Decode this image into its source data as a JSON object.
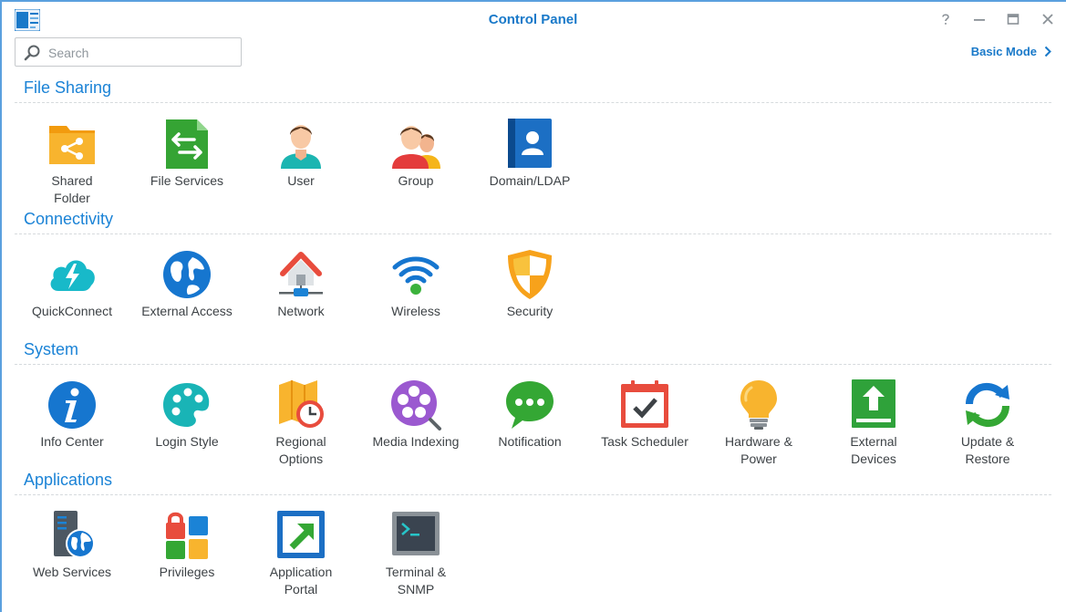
{
  "window": {
    "title": "Control Panel"
  },
  "search": {
    "placeholder": "Search"
  },
  "basic_mode": {
    "label": "Basic Mode"
  },
  "sections": [
    {
      "title": "File Sharing",
      "items": [
        {
          "label": "Shared\nFolder",
          "icon": "shared-folder-icon"
        },
        {
          "label": "File Services",
          "icon": "file-services-icon"
        },
        {
          "label": "User",
          "icon": "user-icon"
        },
        {
          "label": "Group",
          "icon": "group-icon"
        },
        {
          "label": "Domain/LDAP",
          "icon": "domain-ldap-icon"
        }
      ]
    },
    {
      "title": "Connectivity",
      "items": [
        {
          "label": "QuickConnect",
          "icon": "quickconnect-icon"
        },
        {
          "label": "External Access",
          "icon": "external-access-icon"
        },
        {
          "label": "Network",
          "icon": "network-icon"
        },
        {
          "label": "Wireless",
          "icon": "wireless-icon"
        },
        {
          "label": "Security",
          "icon": "security-shield-icon"
        }
      ]
    },
    {
      "title": "System",
      "items": [
        {
          "label": "Info Center",
          "icon": "info-center-icon"
        },
        {
          "label": "Login Style",
          "icon": "login-style-palette-icon"
        },
        {
          "label": "Regional\nOptions",
          "icon": "regional-options-icon"
        },
        {
          "label": "Media Indexing",
          "icon": "media-indexing-icon"
        },
        {
          "label": "Notification",
          "icon": "notification-icon"
        },
        {
          "label": "Task Scheduler",
          "icon": "task-scheduler-icon"
        },
        {
          "label": "Hardware &\nPower",
          "icon": "hardware-power-bulb-icon"
        },
        {
          "label": "External\nDevices",
          "icon": "external-devices-icon"
        },
        {
          "label": "Update &\nRestore",
          "icon": "update-restore-icon"
        }
      ]
    },
    {
      "title": "Applications",
      "items": [
        {
          "label": "Web Services",
          "icon": "web-services-icon"
        },
        {
          "label": "Privileges",
          "icon": "privileges-icon"
        },
        {
          "label": "Application\nPortal",
          "icon": "application-portal-icon"
        },
        {
          "label": "Terminal &\nSNMP",
          "icon": "terminal-snmp-icon"
        }
      ]
    }
  ],
  "colors": {
    "accent": "#1979c9",
    "section": "#1b83d6",
    "text": "#3d4246"
  }
}
